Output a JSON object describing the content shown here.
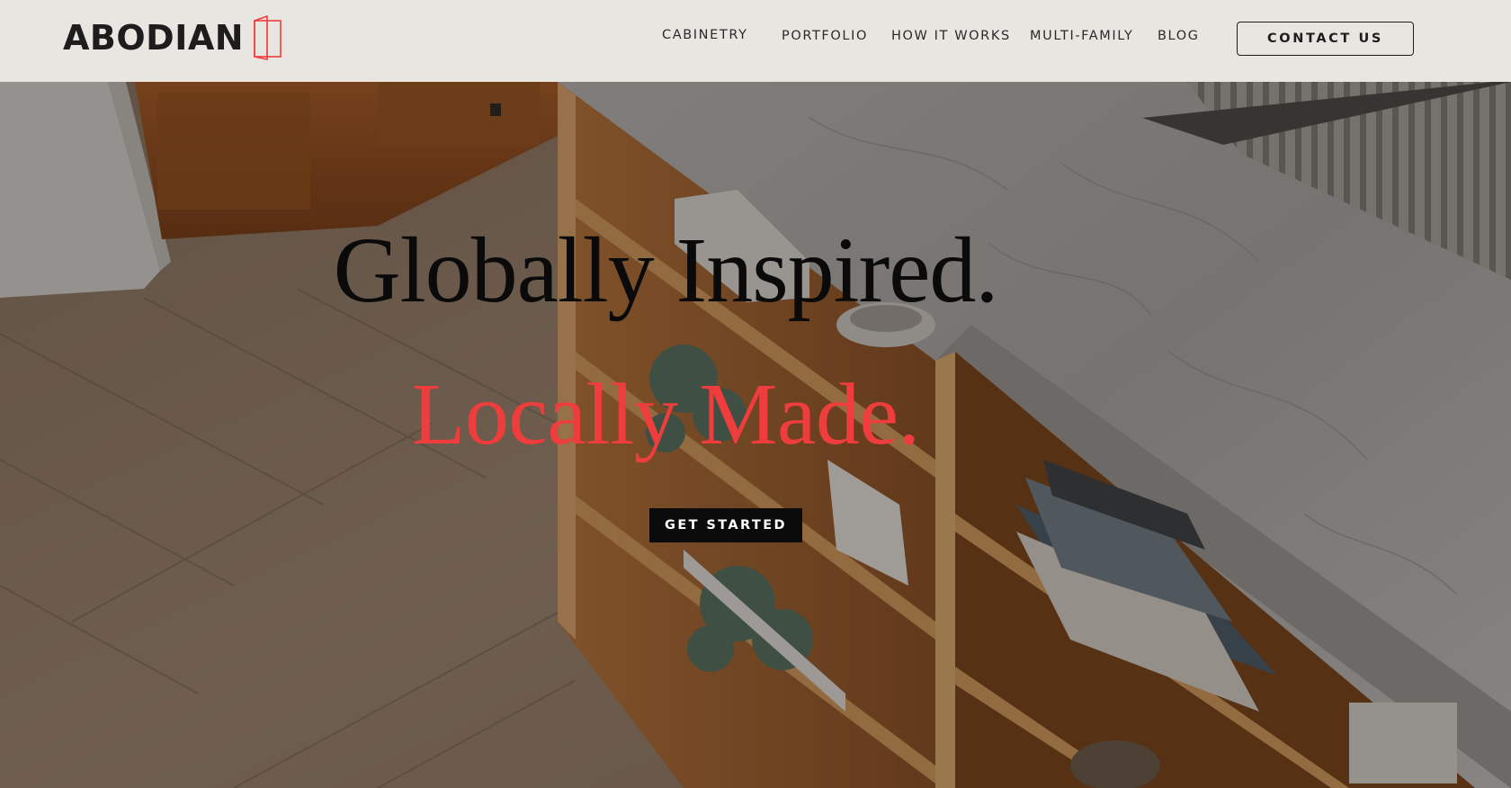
{
  "brand": {
    "name": "ABODIAN",
    "logo_icon": "open-door-icon",
    "accent_color": "#ee3d3c"
  },
  "nav": {
    "items": [
      {
        "label": "CABINETRY"
      },
      {
        "label": "PORTFOLIO"
      },
      {
        "label": "HOW IT WORKS"
      },
      {
        "label": "MULTI-FAMILY"
      },
      {
        "label": "BLOG"
      }
    ],
    "contact_label": "CONTACT US"
  },
  "hero": {
    "headline_line1": "Globally Inspired.",
    "headline_line2": "Locally Made.",
    "headline_line1_color": "#0a0a0a",
    "headline_line2_color": "#ee3d3c",
    "cta_label": "GET STARTED",
    "background_image": "kitchen-island-shelving-photo"
  }
}
